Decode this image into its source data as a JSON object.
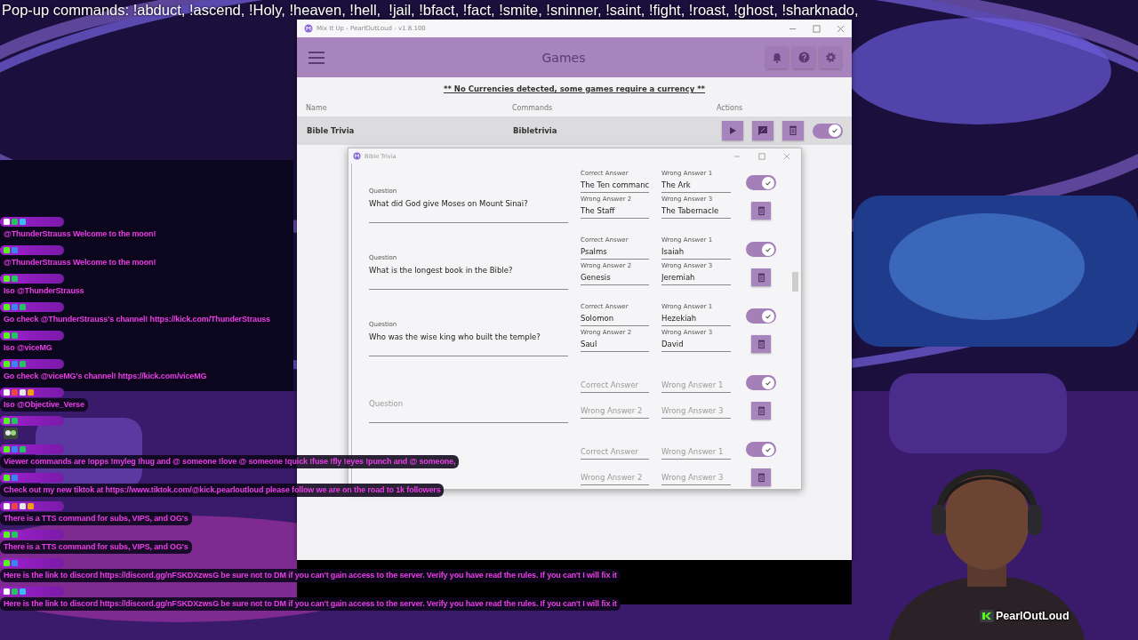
{
  "banner": {
    "text": "Pop-up commands: !abduct, !ascend, !Holy, !heaven, !hell,  !jail, !bfact, !fact, !smite, !sninner, !saint, !fight, !roast, !ghost, !sharknado,"
  },
  "app": {
    "title": "Mix It Up - PearlOutLoud - v1.8.100",
    "page_title": "Games",
    "notice": "** No Currencies detected, some games require a currency **",
    "columns": [
      "Name",
      "Commands",
      "Actions"
    ],
    "games": [
      {
        "name": "Bible Trivia",
        "command": "Bibletrivia",
        "enabled": true,
        "selected": true
      }
    ]
  },
  "dialog": {
    "title": "Bible Trivia",
    "questions": [
      {
        "question": {
          "label": "Question",
          "value": "What did God give Moses on Mount Sinai?"
        },
        "answers": [
          {
            "label": "Correct Answer",
            "value": "The Ten commanc"
          },
          {
            "label": "Wrong Answer 1",
            "value": "The Ark"
          },
          {
            "label": "Wrong Answer 2",
            "value": "The Staff"
          },
          {
            "label": "Wrong Answer 3",
            "value": "The Tabernacle"
          }
        ],
        "enabled": true
      },
      {
        "question": {
          "label": "Question",
          "value": "What is the longest book in the Bible?"
        },
        "answers": [
          {
            "label": "Correct Answer",
            "value": "Psalms"
          },
          {
            "label": "Wrong Answer 1",
            "value": "Isaiah"
          },
          {
            "label": "Wrong Answer 2",
            "value": "Genesis"
          },
          {
            "label": "Wrong Answer 3",
            "value": "Jeremiah"
          }
        ],
        "enabled": true
      },
      {
        "question": {
          "label": "Question",
          "value": "Who was the wise king who built the temple?"
        },
        "answers": [
          {
            "label": "Correct Answer",
            "value": "Solomon"
          },
          {
            "label": "Wrong Answer 1",
            "value": "Hezekiah"
          },
          {
            "label": "Wrong Answer 2",
            "value": "Saul"
          },
          {
            "label": "Wrong Answer 3",
            "value": "David"
          }
        ],
        "enabled": true
      },
      {
        "question": {
          "placeholder": "Question"
        },
        "answers": [
          {
            "placeholder": "Correct Answer"
          },
          {
            "placeholder": "Wrong Answer 1"
          },
          {
            "placeholder": "Wrong Answer 2"
          },
          {
            "placeholder": "Wrong Answer 3"
          }
        ],
        "enabled": true
      },
      {
        "answers": [
          {
            "placeholder": "Correct Answer"
          },
          {
            "placeholder": "Wrong Answer 1"
          },
          {
            "placeholder": "Wrong Answer 2"
          },
          {
            "placeholder": "Wrong Answer 3"
          }
        ],
        "enabled": true
      }
    ]
  },
  "chat": [
    {
      "kind": "text",
      "badges": [
        {
          "color": "#ffffff"
        },
        {
          "color": "#22c55e"
        },
        {
          "color": "#38bdf8"
        }
      ],
      "text": "@ThunderStrauss Welcome to the moon!"
    },
    {
      "kind": "text",
      "badges": [
        {
          "color": "#53fc18"
        },
        {
          "color": "#3b82f6"
        }
      ],
      "text": "@ThunderStrauss Welcome to the moon!"
    },
    {
      "kind": "text",
      "badges": [
        {
          "color": "#53fc18"
        },
        {
          "color": "#22c55e"
        }
      ],
      "text": "Iso @ThunderStrauss"
    },
    {
      "kind": "text",
      "badges": [
        {
          "color": "#53fc18"
        },
        {
          "color": "#3b82f6"
        },
        {
          "color": "#22c55e"
        }
      ],
      "text": "Go check @ThunderStrauss's channel! https://kick.com/ThunderStrauss"
    },
    {
      "kind": "text",
      "badges": [
        {
          "color": "#53fc18"
        },
        {
          "color": "#22c55e"
        }
      ],
      "text": "Iso @viceMG"
    },
    {
      "kind": "text",
      "badges": [
        {
          "color": "#53fc18"
        },
        {
          "color": "#3b82f6"
        },
        {
          "color": "#22c55e"
        }
      ],
      "text": "Go check @viceMG's channel! https://kick.com/viceMG"
    },
    {
      "kind": "text",
      "badges": [
        {
          "color": "#ffffff"
        },
        {
          "color": "#ef4444"
        },
        {
          "color": "#e5e7eb"
        },
        {
          "color": "#f59e0b"
        }
      ],
      "text": "Iso @Objective_Verse"
    },
    {
      "kind": "emote",
      "badges": [
        {
          "color": "#53fc18"
        },
        {
          "color": "#22c55e"
        }
      ]
    },
    {
      "kind": "text",
      "badges": [
        {
          "color": "#53fc18"
        },
        {
          "color": "#3b82f6"
        },
        {
          "color": "#22c55e"
        }
      ],
      "text": "Viewer commands are !opps !myleg !hug and @ someone !love @ someone !quick !fuse !fly !eyes !punch and @ someone,"
    },
    {
      "kind": "text",
      "badges": [
        {
          "color": "#53fc18"
        },
        {
          "color": "#3b82f6"
        }
      ],
      "text": "Check out my new tiktok at https://www.tiktok.com/@kick.pearloutloud please follow we are on the road to 1k followers"
    },
    {
      "kind": "text",
      "badges": [
        {
          "color": "#ffffff"
        },
        {
          "color": "#ef4444"
        },
        {
          "color": "#e5e7eb"
        },
        {
          "color": "#f59e0b"
        }
      ],
      "text": "There is a TTS command for subs, VIPS, and OG's"
    },
    {
      "kind": "text",
      "badges": [
        {
          "color": "#53fc18"
        },
        {
          "color": "#22c55e"
        }
      ],
      "text": "There is a TTS command for subs, VIPS, and OG's"
    },
    {
      "kind": "text",
      "badges": [
        {
          "color": "#53fc18"
        },
        {
          "color": "#3b82f6"
        }
      ],
      "text": "Here is the link to discord https://discord.gg/nFSKDXzwsG be sure not to DM if you can't gain access to the server. Verify you have read the rules. If you can't I will fix it"
    },
    {
      "kind": "text",
      "badges": [
        {
          "color": "#ffffff"
        },
        {
          "color": "#22c55e"
        },
        {
          "color": "#38bdf8"
        }
      ],
      "text": "Here is the link to discord https://discord.gg/nFSKDXzwsG be sure not to DM if you can't gain access to the server. Verify you have read the rules. If you can't I will fix it"
    }
  ],
  "streamer": {
    "name": "PearlOutLoud"
  }
}
